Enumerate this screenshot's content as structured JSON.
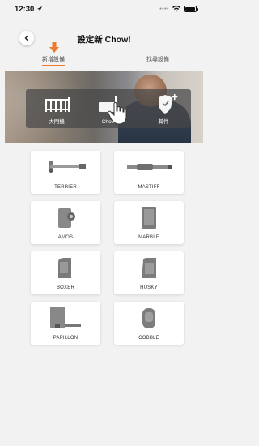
{
  "status_bar": {
    "time": "12:30"
  },
  "nav": {
    "title": "設定新 Chow!"
  },
  "tabs": [
    {
      "label": "新增設備",
      "active": true
    },
    {
      "label": "找尋設備",
      "active": false
    }
  ],
  "hero": {
    "items": [
      {
        "label": "大門機",
        "icon": "gate-icon"
      },
      {
        "label": "Chow",
        "icon": "chow-device-icon"
      },
      {
        "label": "其件",
        "icon": "shield-plus-icon"
      }
    ]
  },
  "products": [
    {
      "label": "TERRIER",
      "icon": "terrier-arm-icon"
    },
    {
      "label": "MASTIFF",
      "icon": "mastiff-arm-icon"
    },
    {
      "label": "AMOS",
      "icon": "amos-motor-icon"
    },
    {
      "label": "MARBLE",
      "icon": "marble-motor-icon"
    },
    {
      "label": "BOXER",
      "icon": "boxer-motor-icon"
    },
    {
      "label": "HUSKY",
      "icon": "husky-motor-icon"
    },
    {
      "label": "PAPILLON",
      "icon": "papillon-motor-icon"
    },
    {
      "label": "COBBLE",
      "icon": "cobble-motor-icon"
    }
  ],
  "colors": {
    "accent": "#ee7b2c",
    "background": "#f2f2f2",
    "card": "#ffffff"
  }
}
